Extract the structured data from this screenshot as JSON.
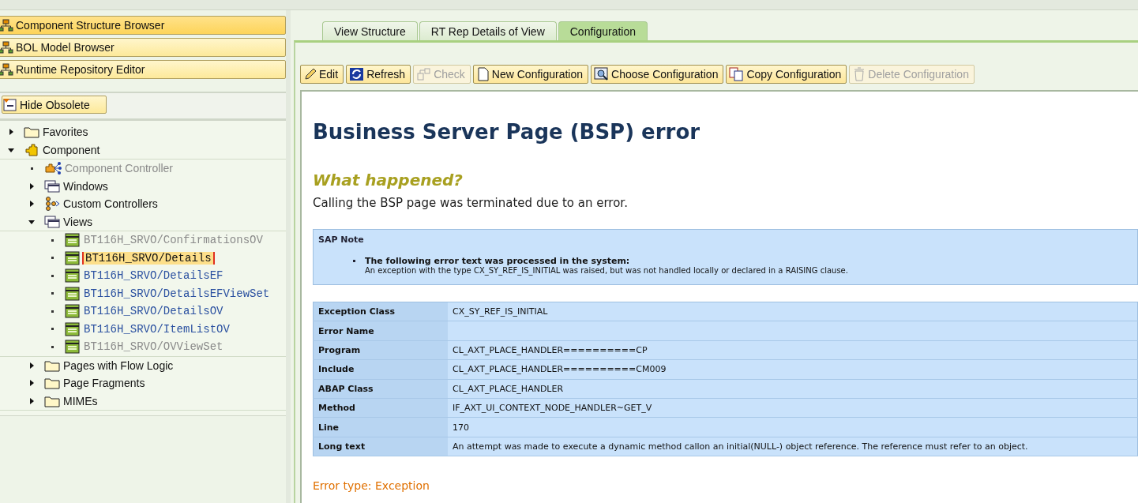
{
  "navigation": [
    {
      "label": "Component Structure Browser",
      "selected": true
    },
    {
      "label": "BOL Model Browser",
      "selected": false
    },
    {
      "label": "Runtime Repository Editor",
      "selected": false
    }
  ],
  "hide_obsolete_button": "Hide Obsolete",
  "tree": [
    {
      "label": "Favorites",
      "kind": "folder",
      "expanded": false,
      "disabled": false,
      "selected": false
    },
    {
      "label": "Component",
      "kind": "component",
      "expanded": true,
      "disabled": false,
      "selected": false,
      "children": [
        {
          "label": "Component Controller",
          "kind": "controller",
          "disabled": true,
          "selected": false
        },
        {
          "label": "Windows",
          "kind": "window",
          "expanded": false,
          "disabled": false,
          "selected": false
        },
        {
          "label": "Custom Controllers",
          "kind": "custom",
          "expanded": false,
          "disabled": false,
          "selected": false
        },
        {
          "label": "Views",
          "kind": "window",
          "expanded": true,
          "disabled": false,
          "selected": false,
          "children": [
            {
              "label": "BT116H_SRVO/ConfirmationsOV",
              "kind": "view",
              "disabled": true,
              "selected": false
            },
            {
              "label": "BT116H_SRVO/Details",
              "kind": "view",
              "disabled": false,
              "selected": true
            },
            {
              "label": "BT116H_SRVO/DetailsEF",
              "kind": "view",
              "disabled": false,
              "selected": false
            },
            {
              "label": "BT116H_SRVO/DetailsEFViewSet",
              "kind": "view",
              "disabled": false,
              "selected": false
            },
            {
              "label": "BT116H_SRVO/DetailsOV",
              "kind": "view",
              "disabled": false,
              "selected": false
            },
            {
              "label": "BT116H_SRVO/ItemListOV",
              "kind": "view",
              "disabled": false,
              "selected": false
            },
            {
              "label": "BT116H_SRVO/OVViewSet",
              "kind": "view",
              "disabled": true,
              "selected": false
            }
          ]
        },
        {
          "label": "Pages with Flow Logic",
          "kind": "folder",
          "expanded": false,
          "disabled": false,
          "selected": false
        },
        {
          "label": "Page Fragments",
          "kind": "folder",
          "expanded": false,
          "disabled": false,
          "selected": false
        },
        {
          "label": "MIMEs",
          "kind": "folder",
          "expanded": false,
          "disabled": false,
          "selected": false
        }
      ]
    }
  ],
  "tabs": [
    {
      "label": "View Structure",
      "selected": false
    },
    {
      "label": "RT Rep Details of View",
      "selected": false
    },
    {
      "label": "Configuration",
      "selected": true
    }
  ],
  "toolbar": [
    {
      "label": "Edit",
      "kind": "edit",
      "disabled": false
    },
    {
      "label": "Refresh",
      "kind": "refresh",
      "disabled": false
    },
    {
      "label": "Check",
      "kind": "check",
      "disabled": true
    },
    {
      "label": "New Configuration",
      "kind": "new",
      "disabled": false
    },
    {
      "label": "Choose Configuration",
      "kind": "choose",
      "disabled": false
    },
    {
      "label": "Copy Configuration",
      "kind": "copy",
      "disabled": false
    },
    {
      "label": "Delete Configuration",
      "kind": "delete",
      "disabled": true
    }
  ],
  "error_page": {
    "title": "Business Server Page (BSP) error",
    "subtitle": "What happened?",
    "message": "Calling the BSP page was terminated due to an error.",
    "sap_note": {
      "title": "SAP Note",
      "bullet_title": "The following error text was processed in the system:",
      "bullet_text": "An exception with the type CX_SY_REF_IS_INITIAL was raised, but was not handled locally or declared in a RAISING clause."
    },
    "details": [
      {
        "label": "Exception Class",
        "value": "CX_SY_REF_IS_INITIAL"
      },
      {
        "label": "Error Name"
      },
      {
        "label": "Program",
        "value": "CL_AXT_PLACE_HANDLER==========CP"
      },
      {
        "label": "Include",
        "value": "CL_AXT_PLACE_HANDLER==========CM009"
      },
      {
        "label": "ABAP Class",
        "value": "CL_AXT_PLACE_HANDLER"
      },
      {
        "label": "Method",
        "value": "IF_AXT_UI_CONTEXT_NODE_HANDLER~GET_V"
      },
      {
        "label": "Line",
        "value": "170"
      },
      {
        "label": "Long text",
        "value": "An attempt was made to execute a dynamic method callon an initial(NULL-) object reference. The reference must refer to an object."
      }
    ],
    "error_type": "Error type: Exception"
  }
}
